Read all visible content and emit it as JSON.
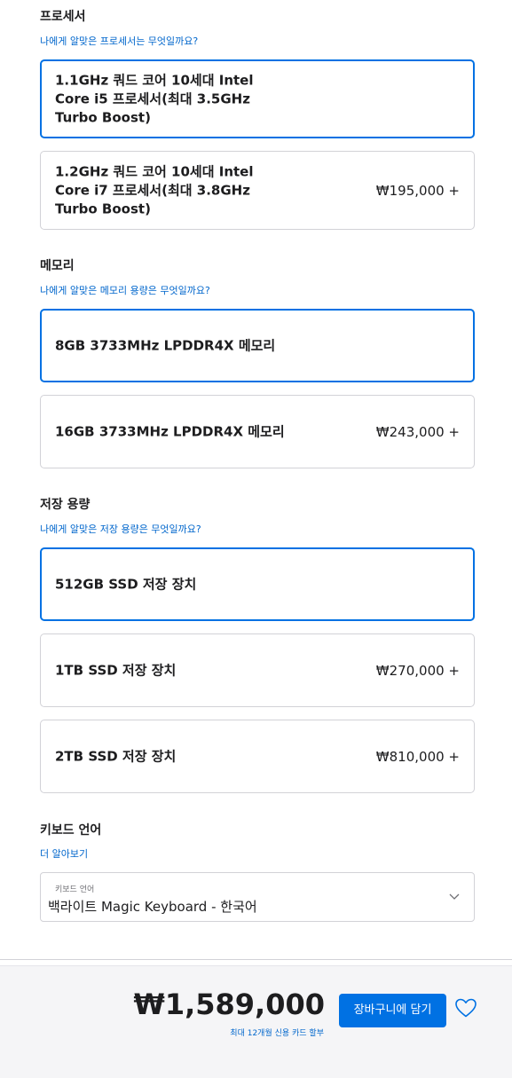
{
  "processor": {
    "title": "프로세서",
    "help_link": "나에게 알맞은 프로세서는 무엇일까요?",
    "options": [
      {
        "label": "1.1GHz 쿼드 코어 10세대 Intel\nCore i5 프로세서(최대 3.5GHz\nTurbo Boost)",
        "price": "",
        "selected": true
      },
      {
        "label": "1.2GHz 쿼드 코어 10세대 Intel\nCore i7 프로세서(최대 3.8GHz\nTurbo Boost)",
        "price": "₩195,000 +",
        "selected": false
      }
    ]
  },
  "memory": {
    "title": "메모리",
    "help_link": "나에게 알맞은 메모리 용량은 무엇일까요?",
    "options": [
      {
        "label": "8GB 3733MHz LPDDR4X 메모리",
        "price": "",
        "selected": true
      },
      {
        "label": "16GB 3733MHz LPDDR4X 메모리",
        "price": "₩243,000 +",
        "selected": false
      }
    ]
  },
  "storage": {
    "title": "저장 용량",
    "help_link": "나에게 알맞은 저장 용량은 무엇일까요?",
    "options": [
      {
        "label": "512GB SSD 저장 장치",
        "price": "",
        "selected": true
      },
      {
        "label": "1TB SSD 저장 장치",
        "price": "₩270,000 +",
        "selected": false
      },
      {
        "label": "2TB SSD 저장 장치",
        "price": "₩810,000 +",
        "selected": false
      }
    ]
  },
  "keyboard": {
    "title": "키보드 언어",
    "help_link": "더 알아보기",
    "select_caption": "키보드 언어",
    "select_value": "백라이트 Magic Keyboard - 한국어",
    "chevron_icon": "chevron-down-icon"
  },
  "footer": {
    "total_price": "₩1,589,000",
    "installment_text": "최대 12개월 신용 카드 할부",
    "add_to_bag_label": "장바구니에 담기",
    "favorite_icon": "heart-icon"
  },
  "colors": {
    "accent": "#0071e3",
    "link": "#0066cc",
    "text": "#1d1d1f",
    "border": "#d2d2d7",
    "footer_bg": "#f5f5f7"
  }
}
